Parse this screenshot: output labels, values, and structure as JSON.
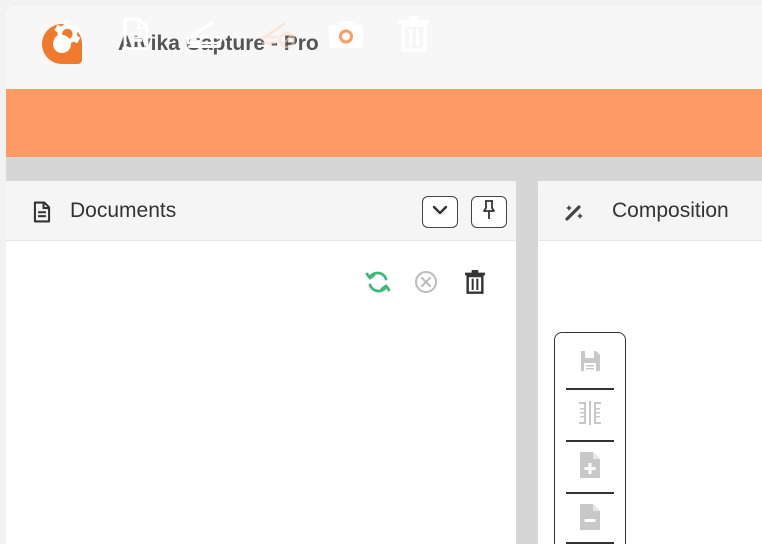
{
  "app": {
    "title": "Aivika Capture - Pro",
    "accent_color": "#fe9b64",
    "logo": "aivika-logo-icon"
  },
  "toolbar": {
    "buttons": [
      {
        "name": "settings",
        "icon": "gear-icon",
        "enabled": true
      },
      {
        "name": "new-document",
        "icon": "document-icon",
        "enabled": true
      },
      {
        "name": "scan",
        "icon": "scanner-icon",
        "enabled": true
      },
      {
        "name": "scan-disabled",
        "icon": "scanner-blocked-icon",
        "enabled": false
      },
      {
        "name": "camera",
        "icon": "camera-icon",
        "enabled": true
      },
      {
        "name": "delete",
        "icon": "trash-icon",
        "enabled": true
      }
    ]
  },
  "documents_panel": {
    "title": "Documents",
    "icon": "document-icon",
    "header_buttons": [
      {
        "name": "collapse",
        "icon": "chevron-down-icon"
      },
      {
        "name": "pin",
        "icon": "pin-icon"
      }
    ],
    "actions": [
      {
        "name": "refresh",
        "icon": "refresh-icon",
        "color": "#3cb878"
      },
      {
        "name": "cancel",
        "icon": "cancel-circle-icon",
        "color": "#bbbbbb"
      },
      {
        "name": "delete",
        "icon": "trash-icon",
        "color": "#333333"
      }
    ]
  },
  "composition_panel": {
    "title": "Composition",
    "icon": "magic-wand-icon",
    "tools": [
      {
        "name": "save",
        "icon": "save-icon"
      },
      {
        "name": "split",
        "icon": "split-icon"
      },
      {
        "name": "add-page",
        "icon": "add-page-icon"
      },
      {
        "name": "remove-page",
        "icon": "remove-page-icon"
      }
    ]
  }
}
